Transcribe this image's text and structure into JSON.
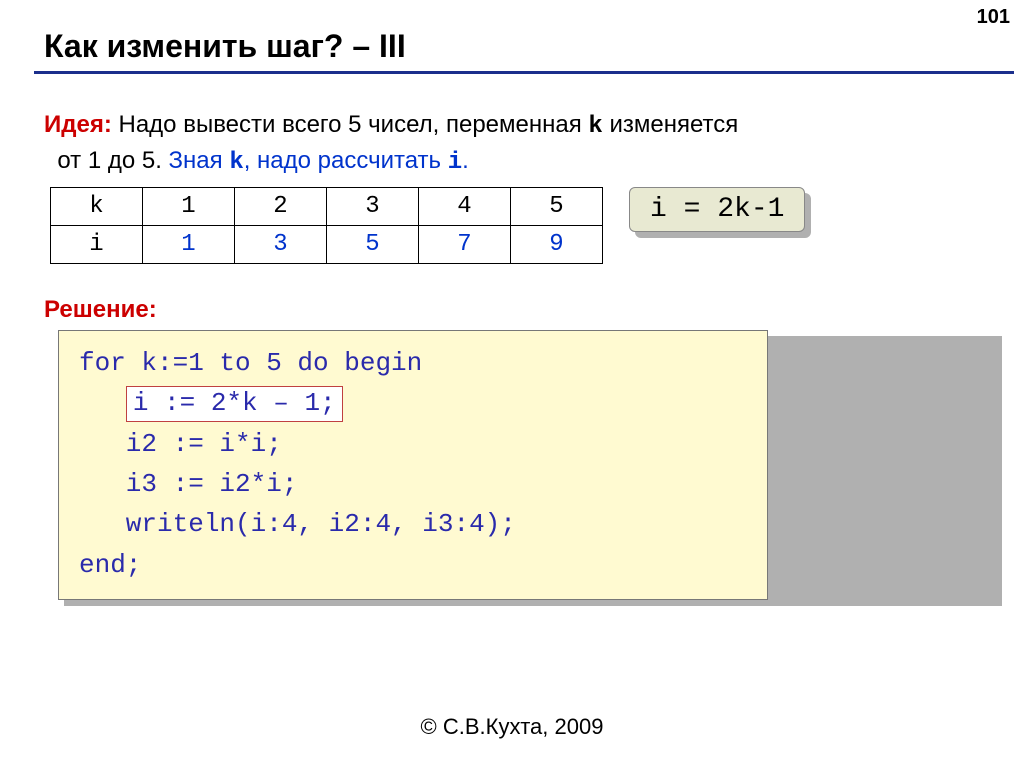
{
  "page_number": "101",
  "title": "Как изменить шаг? – III",
  "idea": {
    "label": "Идея:",
    "part1": " Надо вывести всего 5 чисел, переменная ",
    "var_k": "k",
    "part2": " изменяется",
    "line2_a": "от 1 до 5. ",
    "accent": "Зная ",
    "var_k2": "k",
    "accent2": ", надо рассчитать ",
    "var_i": "i",
    "accent3": "."
  },
  "table": {
    "row_k_label": "k",
    "row_i_label": "i",
    "k": [
      "1",
      "2",
      "3",
      "4",
      "5"
    ],
    "i": [
      "1",
      "3",
      "5",
      "7",
      "9"
    ]
  },
  "formula": "i = 2k-1",
  "solution_label": "Решение:",
  "code": {
    "l1": "for k:=1 to 5 do begin",
    "l2_hl": "i := 2*k – 1;",
    "l3": "   i2 := i*i;",
    "l4": "   i3 := i2*i;",
    "l5": "   writeln(i:4, i2:4, i3:4);",
    "l6": "end;"
  },
  "footer": "© С.В.Кухта, 2009"
}
